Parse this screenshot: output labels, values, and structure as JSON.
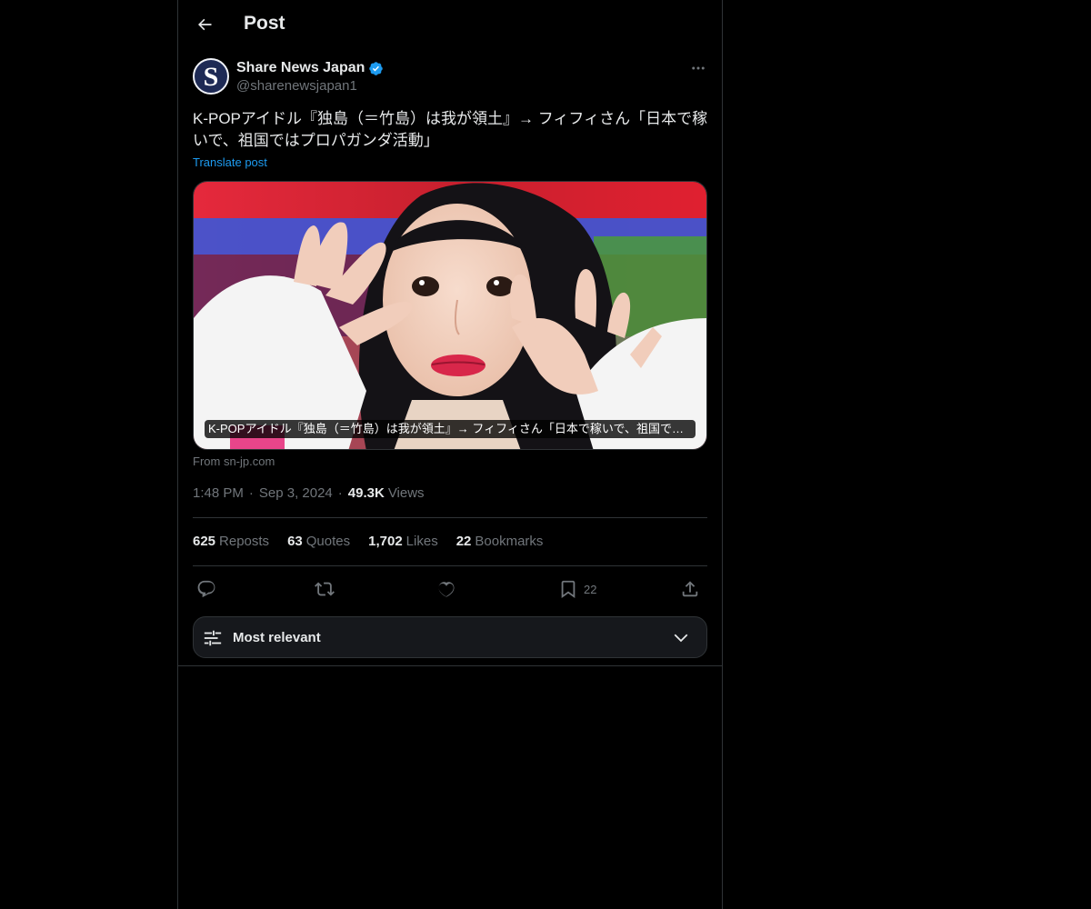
{
  "header": {
    "title": "Post",
    "back_icon": "arrow-left-icon"
  },
  "author": {
    "display_name": "Share News Japan",
    "handle": "@sharenewsjapan1",
    "avatar_letter": "S",
    "verified": true,
    "verified_color": "#1d9bf0"
  },
  "post": {
    "text": "K-POPアイドル『独島（＝竹島）は我が領土』→ フィフィさん「日本で稼いで、祖国ではプロパガンダ活動」",
    "translate_label": "Translate post",
    "media_caption": "K-POPアイドル『独島（＝竹島）は我が領土』→ フィフィさん「日本で稼いで、祖国では...",
    "from_label": "From sn-jp.com"
  },
  "meta": {
    "time": "1:48 PM",
    "date": "Sep 3, 2024",
    "views_count": "49.3K",
    "views_label": "Views"
  },
  "stats": {
    "reposts_count": "625",
    "reposts_label": "Reposts",
    "quotes_count": "63",
    "quotes_label": "Quotes",
    "likes_count": "1,702",
    "likes_label": "Likes",
    "bookmarks_count": "22",
    "bookmarks_label": "Bookmarks"
  },
  "actions": {
    "reply_icon": "reply-icon",
    "repost_icon": "repost-icon",
    "like_icon": "heart-icon",
    "bookmark_icon": "bookmark-icon",
    "bookmark_count": "22",
    "share_icon": "share-icon"
  },
  "sort": {
    "label": "Most relevant",
    "icon": "sliders-icon",
    "chevron": "chevron-down-icon"
  },
  "colors": {
    "background": "#000000",
    "text": "#e7e9ea",
    "muted": "#71767b",
    "accent": "#1d9bf0",
    "border": "#2f3336"
  }
}
